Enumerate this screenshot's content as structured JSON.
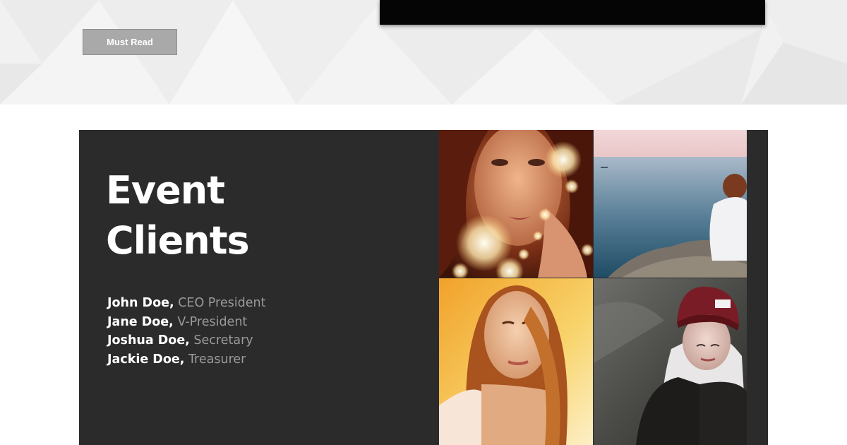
{
  "hero": {
    "must_read_label": "Must Read"
  },
  "clients": {
    "title_line1": "Event",
    "title_line2": "Clients",
    "people": [
      {
        "name": "John Doe,",
        "role": "CEO President"
      },
      {
        "name": "Jane Doe,",
        "role": "V-President"
      },
      {
        "name": "Joshua Doe,",
        "role": "Secretary"
      },
      {
        "name": "Jackie Doe,",
        "role": "Treasurer"
      }
    ]
  },
  "colors": {
    "panel_background": "#2b2b2b",
    "hero_background": "#f0f0f0",
    "button_background": "#a9a9a9",
    "role_text": "#9a9a9a"
  },
  "photos": [
    {
      "icon": "portrait-fairy-lights-photo"
    },
    {
      "icon": "woman-by-sea-photo"
    },
    {
      "icon": "portrait-golden-hair-photo"
    },
    {
      "icon": "woman-in-beanie-photo"
    }
  ]
}
